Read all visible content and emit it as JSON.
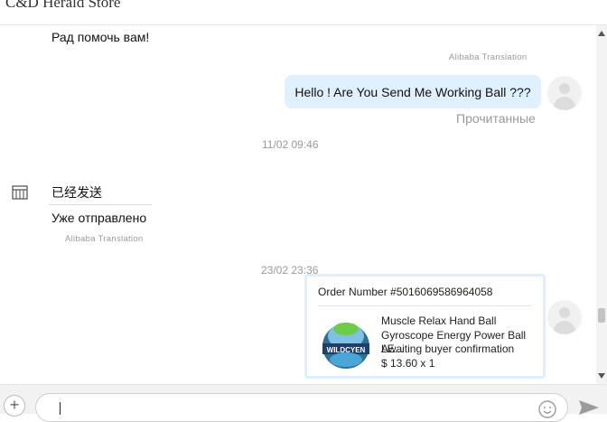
{
  "header": {
    "store_title": "C&D Herald Store"
  },
  "messages": {
    "cut_line": "...       ...",
    "reply_ru": "Рад помочь вам!",
    "translation_tag_1": "Alibaba Translation",
    "outgoing_text": "Hello ! Are You Send Me Working Ball ???",
    "read_status": "Прочитанные",
    "time_1": "11/02 09:46",
    "store_msg_zh": "已经发送",
    "store_msg_ru": "Уже отправлено",
    "translation_tag_2": "Alibaba Translation",
    "time_2": "23/02 23:36"
  },
  "order_card": {
    "order_number": "Order Number #5016069586964058",
    "product_title": "Muscle Relax Hand Ball Gyroscope Energy Power Ball LE...",
    "status": "Awaiting buyer confirmation",
    "price": "$ 13.60 x 1",
    "image_label": "WILDCYEN"
  },
  "composer": {
    "plus_label": "+",
    "message_value": ""
  },
  "icons": {
    "store": "store-icon",
    "emoji": "emoji-icon",
    "send": "send-icon",
    "avatar": "avatar-icon"
  },
  "colors": {
    "bubble": "#dff0ff",
    "order_border": "#dceeff",
    "muted": "#999999"
  }
}
